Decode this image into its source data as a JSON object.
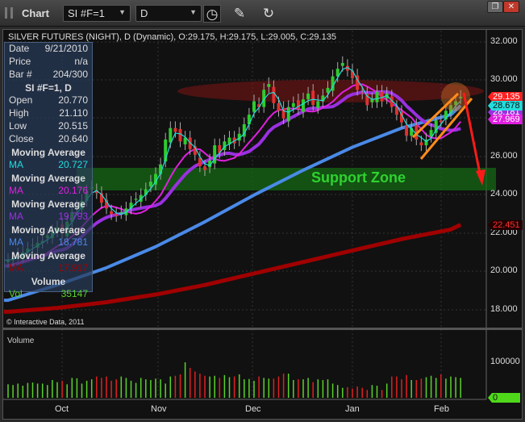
{
  "window": {
    "title": "Chart",
    "symbol": "SI #F=1",
    "interval": "D"
  },
  "header": "SILVER FUTURES (NIGHT), D (Dynamic), O:29.175, H:29.175, L:29.005, C:29.135",
  "data_window": {
    "rows": [
      [
        "Date",
        "9/21/2010"
      ],
      [
        "Price",
        "n/a"
      ],
      [
        "Bar #",
        "204/300"
      ]
    ],
    "symbol_title": "SI #F=1, D",
    "ohlc": [
      [
        "Open",
        "20.770"
      ],
      [
        "High",
        "21.110"
      ],
      [
        "Low",
        "20.515"
      ],
      [
        "Close",
        "20.640"
      ]
    ],
    "mas": [
      {
        "title": "Moving Average",
        "label": "MA",
        "value": "20.727",
        "color": "#22dddd"
      },
      {
        "title": "Moving Average",
        "label": "MA",
        "value": "20.176",
        "color": "#e020e0"
      },
      {
        "title": "Moving Average",
        "label": "MA",
        "value": "19.793",
        "color": "#9a30e0"
      },
      {
        "title": "Moving Average",
        "label": "MA",
        "value": "18.781",
        "color": "#4a8ae8"
      },
      {
        "title": "Moving Average",
        "label": "MA",
        "value": "17.917",
        "color": "#a00000"
      }
    ],
    "volume_title": "Volume",
    "vol_label": "Vol",
    "vol_value": "35147"
  },
  "annotation": "Support Zone",
  "copyright": "© Interactive Data, 2011",
  "volume_pane_title": "Volume",
  "chart_data": {
    "type": "candlestick",
    "y_ticks": [
      "32.000",
      "30.000",
      "28.000",
      "26.000",
      "24.000",
      "22.000",
      "20.000",
      "18.000"
    ],
    "ylim": [
      18,
      32
    ],
    "x_ticks": [
      "Oct",
      "Nov",
      "Dec",
      "Jan",
      "Feb"
    ],
    "price_flags": [
      {
        "value": "29.135",
        "color": "#ff2020"
      },
      {
        "value": "28.678",
        "color": "#22dddd"
      },
      {
        "value": "28.181",
        "color": "#9a30e0"
      },
      {
        "value": "27.969",
        "color": "#e020e0"
      },
      {
        "value": "22.451",
        "color": "#a00000"
      }
    ],
    "closes": [
      20.6,
      20.7,
      20.9,
      21.0,
      21.2,
      21.4,
      21.5,
      21.6,
      21.9,
      22.1,
      22.3,
      22.0,
      22.6,
      23.1,
      23.4,
      23.7,
      24.2,
      24.4,
      24.1,
      23.6,
      23.3,
      23.0,
      22.9,
      23.1,
      23.3,
      23.6,
      23.8,
      24.0,
      24.3,
      24.7,
      25.1,
      25.6,
      26.9,
      27.5,
      27.3,
      26.8,
      27.0,
      26.4,
      26.1,
      25.5,
      25.3,
      25.8,
      26.6,
      26.2,
      26.8,
      27.0,
      26.7,
      27.2,
      27.7,
      28.2,
      28.9,
      28.6,
      29.5,
      29.8,
      28.8,
      28.4,
      28.0,
      28.6,
      28.8,
      28.5,
      29.0,
      29.3,
      28.7,
      28.9,
      29.2,
      29.6,
      30.2,
      30.6,
      30.9,
      30.5,
      30.1,
      29.5,
      29.3,
      28.7,
      29.0,
      29.4,
      28.9,
      29.3,
      28.6,
      28.2,
      27.8,
      27.1,
      27.5,
      26.9,
      26.6,
      26.9,
      27.4,
      27.9,
      27.8,
      28.4,
      28.7,
      28.9,
      29.135
    ],
    "slow_ma_blue": [
      18.5,
      19.3,
      20.2,
      21.3,
      22.6,
      24.0,
      25.3,
      26.5,
      27.5,
      28.2,
      28.678
    ],
    "slow_ma_red": [
      17.9,
      18.1,
      18.4,
      18.8,
      19.3,
      19.9,
      20.5,
      21.1,
      21.7,
      22.2,
      22.451
    ],
    "volume_ticks": [
      "100000",
      "0"
    ],
    "volume_last": "0",
    "volumes": [
      38,
      36,
      40,
      34,
      42,
      43,
      40,
      40,
      36,
      50,
      44,
      48,
      38,
      56,
      55,
      40,
      48,
      52,
      60,
      56,
      60,
      48,
      52,
      60,
      56,
      48,
      42,
      56,
      52,
      50,
      54,
      52,
      40,
      60,
      62,
      66,
      100,
      84,
      74,
      68,
      62,
      60,
      62,
      56,
      64,
      58,
      60,
      66,
      52,
      53,
      48,
      60,
      56,
      54,
      54,
      60,
      68,
      68,
      50,
      52,
      52,
      56,
      44,
      52,
      50,
      52,
      40,
      36,
      28,
      30,
      26,
      32,
      28,
      22,
      36,
      34,
      22,
      40,
      60,
      60,
      52,
      64,
      50,
      50,
      54,
      58,
      62,
      56,
      66,
      54,
      60,
      58,
      56
    ]
  }
}
